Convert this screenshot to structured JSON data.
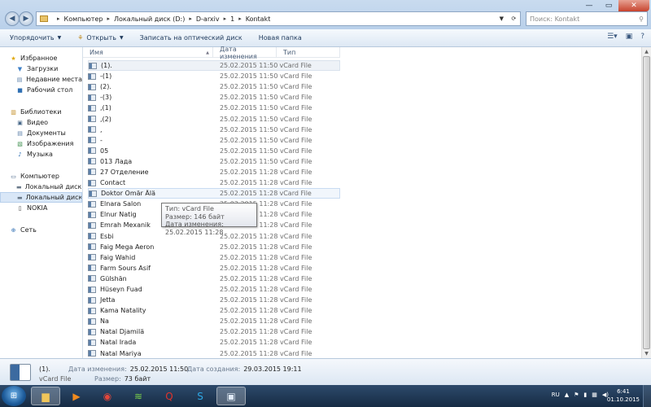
{
  "window": {
    "minimize": "—",
    "maximize": "▭",
    "close": "✕"
  },
  "address": {
    "crumbs": [
      "Компьютер",
      "Локальный диск (D:)",
      "D-arxiv",
      "1",
      "Kontakt"
    ],
    "icon": "folder-icon"
  },
  "search": {
    "placeholder": "Поиск: Kontakt"
  },
  "toolbar": {
    "organize": "Упорядочить",
    "open": "Открыть",
    "burn": "Записать на оптический диск",
    "new_folder": "Новая папка"
  },
  "nav": {
    "favorites": "Избранное",
    "downloads": "Загрузки",
    "recent": "Недавние места",
    "desktop": "Рабочий стол",
    "libraries": "Библиотеки",
    "video": "Видео",
    "documents": "Документы",
    "images": "Изображения",
    "music": "Музыка",
    "computer": "Компьютер",
    "disk_c": "Локальный диск (C",
    "disk_d": "Локальный диск (D",
    "nokia": "NOKIA",
    "network": "Сеть"
  },
  "columns": {
    "name": "Имя",
    "date": "Дата изменения",
    "type": "Тип"
  },
  "files": [
    {
      "name": "(1).",
      "date": "25.02.2015 11:50",
      "type": "vCard File"
    },
    {
      "name": "-(1)",
      "date": "25.02.2015 11:50",
      "type": "vCard File"
    },
    {
      "name": "(2).",
      "date": "25.02.2015 11:50",
      "type": "vCard File"
    },
    {
      "name": "-(3)",
      "date": "25.02.2015 11:50",
      "type": "vCard File"
    },
    {
      "name": ",(1)",
      "date": "25.02.2015 11:50",
      "type": "vCard File"
    },
    {
      "name": ",(2)",
      "date": "25.02.2015 11:50",
      "type": "vCard File"
    },
    {
      "name": ",",
      "date": "25.02.2015 11:50",
      "type": "vCard File"
    },
    {
      "name": "-",
      "date": "25.02.2015 11:50",
      "type": "vCard File"
    },
    {
      "name": "05",
      "date": "25.02.2015 11:50",
      "type": "vCard File"
    },
    {
      "name": "013 Лада",
      "date": "25.02.2015 11:50",
      "type": "vCard File"
    },
    {
      "name": "27 Отделение",
      "date": "25.02.2015 11:28",
      "type": "vCard File"
    },
    {
      "name": "Contact",
      "date": "25.02.2015 11:28",
      "type": "vCard File"
    },
    {
      "name": "Doktor Ömär Älä",
      "date": "25.02.2015 11:28",
      "type": "vCard File"
    },
    {
      "name": "Elnara Salon",
      "date": "25.02.2015 11:28",
      "type": "vCard File"
    },
    {
      "name": "Elnur Natig",
      "date": "25.02.2015 11:28",
      "type": "vCard File"
    },
    {
      "name": "Emrah Mexanik",
      "date": "25.02.2015 11:28",
      "type": "vCard File"
    },
    {
      "name": "Esbi",
      "date": "25.02.2015 11:28",
      "type": "vCard File"
    },
    {
      "name": "Faig Mega Aeron",
      "date": "25.02.2015 11:28",
      "type": "vCard File"
    },
    {
      "name": "Faig Wahid",
      "date": "25.02.2015 11:28",
      "type": "vCard File"
    },
    {
      "name": "Farm Sours Asif",
      "date": "25.02.2015 11:28",
      "type": "vCard File"
    },
    {
      "name": "Gülshän",
      "date": "25.02.2015 11:28",
      "type": "vCard File"
    },
    {
      "name": "Hüseyn Fuad",
      "date": "25.02.2015 11:28",
      "type": "vCard File"
    },
    {
      "name": "Jetta",
      "date": "25.02.2015 11:28",
      "type": "vCard File"
    },
    {
      "name": "Kama Natality",
      "date": "25.02.2015 11:28",
      "type": "vCard File"
    },
    {
      "name": "Na",
      "date": "25.02.2015 11:28",
      "type": "vCard File"
    },
    {
      "name": "Natal Djamilä",
      "date": "25.02.2015 11:28",
      "type": "vCard File"
    },
    {
      "name": "Natal Irada",
      "date": "25.02.2015 11:28",
      "type": "vCard File"
    },
    {
      "name": "Natal Mariya",
      "date": "25.02.2015 11:28",
      "type": "vCard File"
    }
  ],
  "tooltip": {
    "type": "Тип: vCard File",
    "size": "Размер: 146 байт",
    "modified": "Дата изменения: 25.02.2015 11:28"
  },
  "details": {
    "name": "(1).",
    "type": "vCard File",
    "modified_label": "Дата изменения:",
    "modified": "25.02.2015 11:50",
    "size_label": "Размер:",
    "size": "73 байт",
    "created_label": "Дата создания:",
    "created": "29.03.2015 19:11"
  },
  "taskbar": {
    "lang": "RU",
    "time": "6:41",
    "date": "01.10.2015"
  }
}
